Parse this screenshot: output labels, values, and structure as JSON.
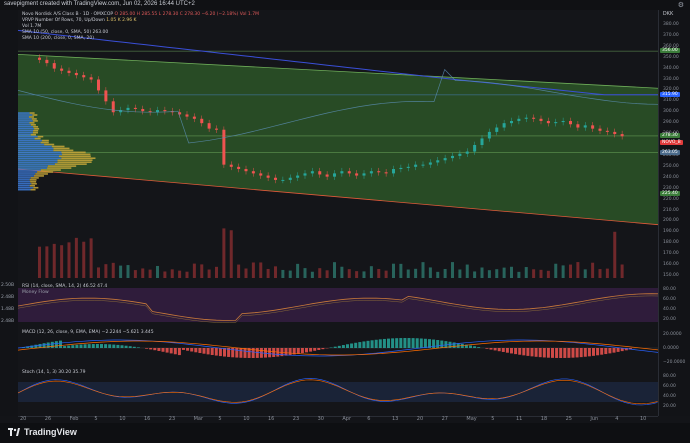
{
  "header": {
    "credit": "savepigment created with TradingView.com, Jun 02, 2026 16:44 UTC+2",
    "currency": "DKK"
  },
  "legend": {
    "main": "Novo Nordisk A/S Class B · 1D · OMXCOP",
    "ohlc": "O 285.00  H 285.55  L 278.30  C 278.30  −6.20 (−2.18%)  Vol 1.7M",
    "vrvp": "VRVP Number Of Rows, 70, Up/Down",
    "vrvp_values": "1.05 K  2.96 K",
    "vol": "Vol  1.7M",
    "sma1": "SMA 10 (50, close, 0, SMA, 50)  263.00",
    "sma2": "SMA 10 (200, close, 0, SMA, 20)"
  },
  "price_axis": {
    "ticks": [
      "380.00",
      "370.00",
      "360.00",
      "350.00",
      "340.00",
      "330.00",
      "320.00",
      "310.00",
      "300.00",
      "290.00",
      "280.00",
      "270.00",
      "260.00",
      "250.00",
      "240.00",
      "230.00",
      "220.00",
      "210.00",
      "200.00",
      "190.00",
      "180.00",
      "170.00",
      "160.00",
      "150.00"
    ],
    "badges": [
      {
        "text": "356.00",
        "color": "#3b7d3a"
      },
      {
        "text": "315.90",
        "color": "#2962ff"
      },
      {
        "text": "278.30",
        "color": "#3b7d3a"
      },
      {
        "text": "NOVO_B",
        "color": "#e23b3b"
      },
      {
        "text": "263.05",
        "color": "#4a6a8a"
      },
      {
        "text": "225.40",
        "color": "#3b7d3a"
      }
    ]
  },
  "rsi": {
    "legend": "RSI (14, close, SMA, 14, 2)  46.52  47.4",
    "ticks": [
      "80.00",
      "60.00",
      "40.00",
      "20.00"
    ],
    "left_ticks": [
      "2.50B",
      "2.48B",
      "1.48B",
      "2.48B"
    ],
    "sublegend": "Money Flow"
  },
  "macd": {
    "legend": "MACD (12, 26, close, 9, EMA, EMA)  −2.2244  −5.621  3.445",
    "ticks": [
      "20.0000",
      "0.0000",
      "−20.0000"
    ]
  },
  "stoch": {
    "legend": "Stoch (14, 1, 3)  30.20  35.79",
    "ticks": [
      "80.00",
      "60.00",
      "40.00",
      "20.00"
    ]
  },
  "time_axis": [
    "20",
    "26",
    "Feb",
    "5",
    "10",
    "16",
    "23",
    "Mar",
    "5",
    "10",
    "16",
    "23",
    "30",
    "Apr",
    "6",
    "13",
    "20",
    "27",
    "May",
    "5",
    "11",
    "18",
    "25",
    "Jun",
    "4",
    "10"
  ],
  "footer": {
    "brand": "TradingView"
  },
  "chart_data": {
    "type": "candlestick",
    "title": "Novo Nordisk A/S Class B · 1D · OMXCOP",
    "ylim": [
      150,
      390
    ],
    "series": [
      {
        "name": "close",
        "values": [
          348,
          345,
          340,
          338,
          336,
          334,
          332,
          330,
          320,
          310,
          300,
          302,
          304,
          303,
          301,
          300,
          302,
          301,
          300,
          298,
          296,
          294,
          290,
          285,
          284,
          252,
          250,
          248,
          246,
          244,
          242,
          240,
          238,
          238,
          240,
          242,
          244,
          246,
          243,
          241,
          244,
          246,
          244,
          242,
          244,
          246,
          245,
          244,
          248,
          249,
          250,
          252,
          252,
          254,
          256,
          258,
          260,
          262,
          264,
          270,
          276,
          282,
          286,
          290,
          292,
          294,
          295,
          294,
          292,
          290,
          291,
          292,
          289,
          286,
          288,
          285,
          283,
          282,
          280,
          278
        ]
      }
    ]
  }
}
